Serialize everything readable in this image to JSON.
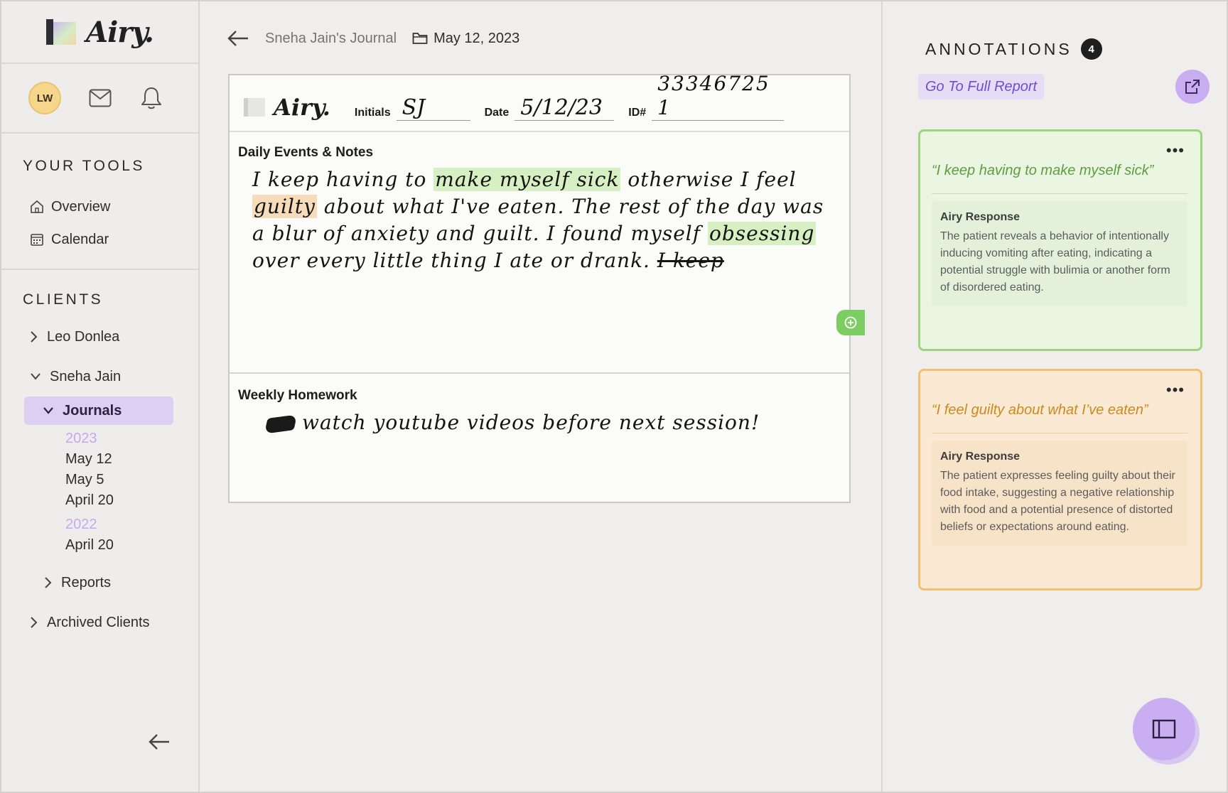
{
  "brand": {
    "name": "Airy."
  },
  "user": {
    "initials": "LW"
  },
  "sidebar": {
    "tools_title": "YOUR TOOLS",
    "tools": [
      {
        "label": "Overview",
        "icon": "home-icon"
      },
      {
        "label": "Calendar",
        "icon": "calendar-icon"
      }
    ],
    "clients_title": "CLIENTS",
    "clients": [
      {
        "label": "Leo Donlea",
        "expanded": false
      },
      {
        "label": "Sneha Jain",
        "expanded": true
      }
    ],
    "journals_label": "Journals",
    "journal_years": [
      {
        "year": "2023",
        "entries": [
          "May 12",
          "May 5",
          "April 20"
        ]
      },
      {
        "year": "2022",
        "entries": [
          "April 20"
        ]
      }
    ],
    "reports_label": "Reports",
    "archived_label": "Archived Clients"
  },
  "topbar": {
    "journal_name": "Sneha Jain's Journal",
    "date": "May 12, 2023"
  },
  "page": {
    "logo": "Airy.",
    "initials_label": "Initials",
    "initials_value": "SJ",
    "date_label": "Date",
    "date_value": "5/12/23",
    "id_label": "ID#",
    "id_value": "33346725 1",
    "notes_label": "Daily Events & Notes",
    "notes": {
      "part1": "I keep having to ",
      "hl1": "make myself sick",
      "part2": " otherwise I feel ",
      "hl2": "guilty",
      "part3": " about what I've eaten. The rest of the day was a blur of anxiety and guilt. I found myself ",
      "hl3": "obsessing",
      "part4": " over every little thing I ate or drank. ",
      "struck": "I keep"
    },
    "homework_label": "Weekly Homework",
    "homework": "watch youtube videos before next session!"
  },
  "annotations": {
    "title": "ANNOTATIONS",
    "count": "4",
    "full_report": "Go To Full Report",
    "cards": [
      {
        "quote": "“I keep having to make myself sick”",
        "response_title": "Airy Response",
        "response": "The patient reveals a behavior of intentionally inducing vomiting after eating, indicating a potential struggle with bulimia or another form of disordered eating.",
        "color": "#9fd37e"
      },
      {
        "quote": "“I feel guilty about what I’ve eaten”",
        "response_title": "Airy Response",
        "response": "The patient expresses feeling guilty about their food intake, suggesting a negative relationship with food and a potential presence of distorted beliefs or expectations around eating.",
        "color": "#f3bf71"
      }
    ]
  }
}
